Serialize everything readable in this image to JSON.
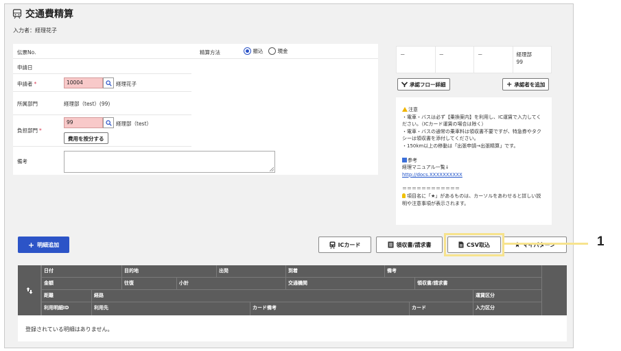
{
  "page": {
    "title": "交通費精算",
    "entrant": "入力者：経理花子"
  },
  "form": {
    "slip_no_label": "伝票No.",
    "method_label": "精算方法",
    "method_options": [
      "振込",
      "現金"
    ],
    "method_selected": "振込",
    "apply_date_label": "申請日",
    "applicant_label": "申請者",
    "applicant_code": "10004",
    "applicant_name": "経理花子",
    "dept_label": "所属部門",
    "dept_value": "経理部（test）(99)",
    "burden_label": "負担部門",
    "burden_code": "99",
    "burden_name": "経理部（test）",
    "split_button": "費用を按分する",
    "memo_label": "備考",
    "required_mark": "*"
  },
  "approvers": {
    "cells": [
      "－",
      "－",
      "－",
      "経理部\n99"
    ],
    "flow_button": "承認フロー詳細",
    "add_button": "承認者を追加"
  },
  "notice": {
    "caution_title": "注意",
    "caution_lines": [
      "・電車・バスは必ず【乗換案内】を利用し、IC運賃で入力してください。（ICカード運賃の場合は除く）",
      "・電車・バスの通常の乗車料は領収書不要ですが、特急券やタクシーは領収書を添付してください。",
      "・150km以上の移動は「出張申請→出張精算」です。"
    ],
    "ref_title": "参考",
    "ref_text": "経理マニュアル一覧↓",
    "ref_link": "http://docs.XXXXXXXXXX",
    "separator": "＝＝＝＝＝＝＝＝＝＝＝＝",
    "tip": "項目名に「★」があるものは、カーソルをあわせると詳しい説明や注意事項が表示されます。"
  },
  "actions": {
    "add_detail": "明細追加",
    "ic_card": "ICカード",
    "receipt": "領収書/請求書",
    "csv_import": "CSV取込",
    "my_pattern": "マイパターン"
  },
  "callout": {
    "number": "1"
  },
  "table": {
    "row1": [
      "日付",
      "目的地",
      "出発",
      "到着",
      "備考"
    ],
    "row2": [
      "金額",
      "往復",
      "小計",
      "交通機関",
      "領収書/請求書"
    ],
    "row3": [
      "距離",
      "経路",
      "運賃区分"
    ],
    "row4": [
      "利用明細ID",
      "利用先",
      "カード備考",
      "カード",
      "入力区分"
    ],
    "empty_message": "登録されている明細はありません。"
  },
  "colors": {
    "primary": "#2c54c7",
    "required": "#d9364f",
    "header_bg": "#5c5c5c",
    "highlight": "#f7e38d",
    "code_input_bg": "#f8c9c9"
  }
}
